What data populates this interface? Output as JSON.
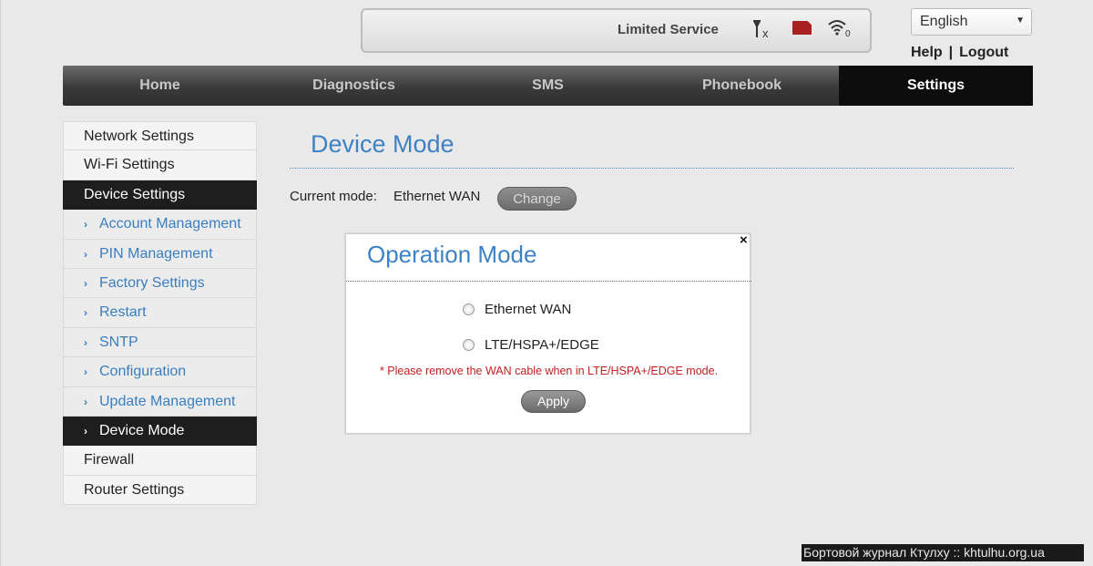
{
  "status": {
    "service_text": "Limited Service",
    "icons": [
      "no-signal-icon",
      "sim-card-icon",
      "wifi-icon"
    ],
    "wifi_count": "0",
    "signal_suffix": "x"
  },
  "language": {
    "selected": "English"
  },
  "top_links": {
    "help": "Help",
    "separator": "|",
    "logout": "Logout"
  },
  "nav": {
    "items": [
      {
        "label": "Home"
      },
      {
        "label": "Diagnostics"
      },
      {
        "label": "SMS"
      },
      {
        "label": "Phonebook"
      },
      {
        "label": "Settings"
      }
    ]
  },
  "sidebar": {
    "items": [
      {
        "label": "Network Settings"
      },
      {
        "label": "Wi-Fi Settings"
      },
      {
        "label": "Device Settings"
      },
      {
        "label": "Account Management"
      },
      {
        "label": "PIN Management"
      },
      {
        "label": "Factory Settings"
      },
      {
        "label": "Restart"
      },
      {
        "label": "SNTP"
      },
      {
        "label": "Configuration"
      },
      {
        "label": "Update Management"
      },
      {
        "label": "Device Mode"
      },
      {
        "label": "Firewall"
      },
      {
        "label": "Router Settings"
      }
    ],
    "chevron": "›"
  },
  "main": {
    "title": "Device Mode",
    "current_mode_label": "Current mode:",
    "current_mode_value": "Ethernet WAN",
    "change_label": "Change"
  },
  "modal": {
    "title": "Operation Mode",
    "close": "×",
    "options": [
      {
        "label": "Ethernet WAN"
      },
      {
        "label": "LTE/HSPA+/EDGE"
      }
    ],
    "warning": "* Please remove the WAN cable when in LTE/HSPA+/EDGE mode.",
    "apply_label": "Apply"
  },
  "watermark": "Бортовой журнал Ктулху :: khtulhu.org.ua",
  "colors": {
    "accent": "#3d82c4",
    "warning": "#c42020",
    "nav_active": "#0d0d0d"
  }
}
